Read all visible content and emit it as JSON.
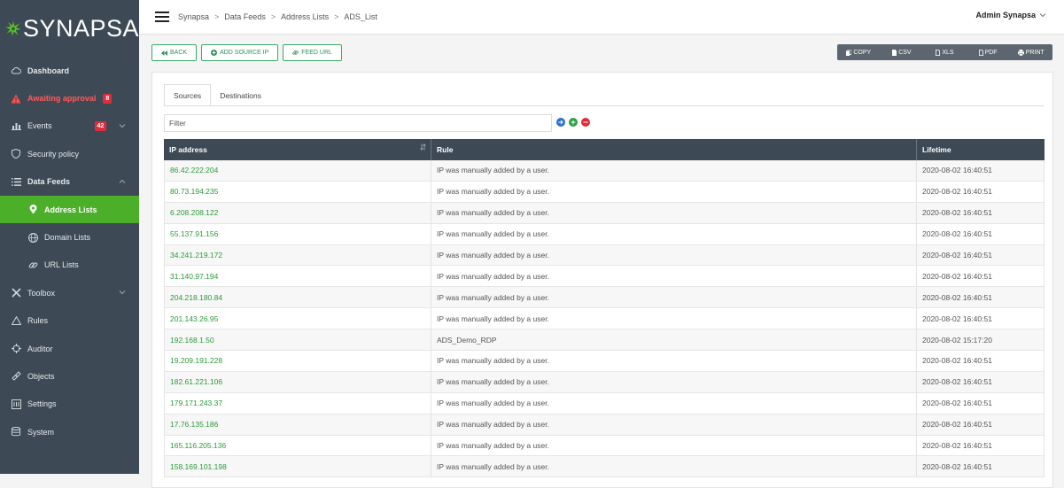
{
  "brand": {
    "name": "SYNAPSA"
  },
  "topbar": {
    "breadcrumbs": [
      "Synapsa",
      "Data Feeds",
      "Address Lists",
      "ADS_List"
    ],
    "breadcrumb_sep": ">",
    "user": "Admin Synapsa"
  },
  "sidebar": {
    "items": [
      {
        "label": "Dashboard",
        "icon": "cloud-icon"
      },
      {
        "label": "Awaiting approval",
        "icon": "warning-icon",
        "badge": "8"
      },
      {
        "label": "Events",
        "icon": "chart-icon",
        "badge": "42"
      },
      {
        "label": "Security policy",
        "icon": "shield-icon"
      },
      {
        "label": "Data Feeds",
        "icon": "list-icon"
      },
      {
        "label": "Address Lists",
        "icon": "map-pin-icon"
      },
      {
        "label": "Domain Lists",
        "icon": "globe-icon"
      },
      {
        "label": "URL Lists",
        "icon": "link-icon"
      },
      {
        "label": "Toolbox",
        "icon": "tools-icon"
      },
      {
        "label": "Rules",
        "icon": "warning-outline-icon"
      },
      {
        "label": "Auditor",
        "icon": "crosshair-icon"
      },
      {
        "label": "Objects",
        "icon": "objects-icon"
      },
      {
        "label": "Settings",
        "icon": "settings-icon"
      },
      {
        "label": "System",
        "icon": "database-icon"
      }
    ]
  },
  "actions": {
    "back": "BACK",
    "add_source_ip": "ADD SOURCE IP",
    "feed_url": "FEED URL"
  },
  "exports": [
    "COPY",
    "CSV",
    "XLS",
    "PDF",
    "PRINT"
  ],
  "tabs": [
    "Sources",
    "Destinations"
  ],
  "filter": {
    "placeholder": "Filter"
  },
  "table": {
    "headers": [
      "IP address",
      "Rule",
      "Lifetime"
    ],
    "rows": [
      [
        "86.42.222.204",
        "IP was manually added by a user.",
        "2020-08-02 16:40:51"
      ],
      [
        "80.73.194.235",
        "IP was manually added by a user.",
        "2020-08-02 16:40:51"
      ],
      [
        "6.208.208.122",
        "IP was manually added by a user.",
        "2020-08-02 16:40:51"
      ],
      [
        "55.137.91.156",
        "IP was manually added by a user.",
        "2020-08-02 16:40:51"
      ],
      [
        "34.241.219.172",
        "IP was manually added by a user.",
        "2020-08-02 16:40:51"
      ],
      [
        "31.140.97.194",
        "IP was manually added by a user.",
        "2020-08-02 16:40:51"
      ],
      [
        "204.218.180.84",
        "IP was manually added by a user.",
        "2020-08-02 16:40:51"
      ],
      [
        "201.143.26.95",
        "IP was manually added by a user.",
        "2020-08-02 16:40:51"
      ],
      [
        "192.168.1.50",
        "ADS_Demo_RDP",
        "2020-08-02 15:17:20"
      ],
      [
        "19.209.191.228",
        "IP was manually added by a user.",
        "2020-08-02 16:40:51"
      ],
      [
        "182.61.221.106",
        "IP was manually added by a user.",
        "2020-08-02 16:40:51"
      ],
      [
        "179.171.243.37",
        "IP was manually added by a user.",
        "2020-08-02 16:40:51"
      ],
      [
        "17.76.135.186",
        "IP was manually added by a user.",
        "2020-08-02 16:40:51"
      ],
      [
        "165.116.205.136",
        "IP was manually added by a user.",
        "2020-08-02 16:40:51"
      ],
      [
        "158.169.101.198",
        "IP was manually added by a user.",
        "2020-08-02 16:40:51"
      ]
    ]
  },
  "colors": {
    "sidebar_bg": "#3d4a56",
    "active_green": "#4caf2a",
    "ip_link": "#2a9a3a",
    "badge_red": "#e02d3c",
    "alert_text": "#ff5a5a"
  }
}
